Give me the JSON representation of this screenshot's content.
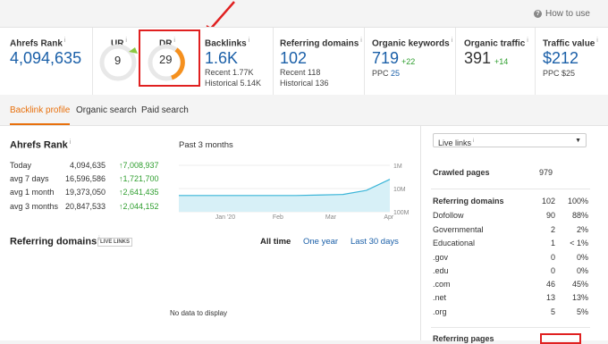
{
  "help": {
    "label": "How to use"
  },
  "metrics": {
    "ahrefs_rank": {
      "label": "Ahrefs Rank",
      "value": "4,094,635"
    },
    "ur": {
      "label": "UR",
      "value": "9"
    },
    "dr": {
      "label": "DR",
      "value": "29"
    },
    "backlinks": {
      "label": "Backlinks",
      "value": "1.6K",
      "recent": "Recent 1.77K",
      "historical": "Historical 5.14K"
    },
    "referring_domains": {
      "label": "Referring domains",
      "value": "102",
      "recent": "Recent 118",
      "historical": "Historical 136"
    },
    "organic_keywords": {
      "label": "Organic keywords",
      "value": "719",
      "delta": "+22",
      "ppc_label": "PPC",
      "ppc": "25"
    },
    "organic_traffic": {
      "label": "Organic traffic",
      "value": "391",
      "delta": "+14"
    },
    "traffic_value": {
      "label": "Traffic value",
      "value": "$212",
      "ppc": "PPC $25"
    }
  },
  "tabs": [
    {
      "label": "Backlink profile"
    },
    {
      "label": "Organic search"
    },
    {
      "label": "Paid search"
    }
  ],
  "rank_section": {
    "title": "Ahrefs Rank",
    "rows": [
      {
        "label": "Today",
        "value": "4,094,635",
        "change": "↑7,008,937"
      },
      {
        "label": "avg 7 days",
        "value": "16,596,586",
        "change": "↑1,721,700"
      },
      {
        "label": "avg 1 month",
        "value": "19,373,050",
        "change": "↑2,641,435"
      },
      {
        "label": "avg 3 months",
        "value": "20,847,533",
        "change": "↑2,044,152"
      }
    ]
  },
  "chart_data": {
    "type": "area",
    "title": "Past 3 months",
    "x_ticks": [
      "Jan '20",
      "Feb",
      "Mar",
      "Apr"
    ],
    "y_ticks": [
      "1M",
      "10M",
      "100M"
    ],
    "scale": "log",
    "series": [
      {
        "values": [
          20000000,
          20000000,
          20000000,
          20000000,
          20000000,
          20000000,
          19000000,
          18000000,
          12000000,
          4000000
        ]
      }
    ]
  },
  "ref_section": {
    "title": "Referring domains",
    "badge": "LIVE LINKS",
    "filters": [
      "All time",
      "One year",
      "Last 30 days"
    ],
    "empty": "No data to display"
  },
  "side": {
    "dropdown": "Live links",
    "crawled_label": "Crawled pages",
    "crawled_value": "979",
    "rows": [
      {
        "label": "Referring domains",
        "value": "102",
        "pct": "100%"
      },
      {
        "label": "Dofollow",
        "value": "90",
        "pct": "88%"
      },
      {
        "label": "Governmental",
        "value": "2",
        "pct": "2%"
      },
      {
        "label": "Educational",
        "value": "1",
        "pct": "< 1%"
      },
      {
        "label": ".gov",
        "value": "0",
        "pct": "0%"
      },
      {
        "label": ".edu",
        "value": "0",
        "pct": "0%"
      },
      {
        "label": ".com",
        "value": "46",
        "pct": "45%"
      },
      {
        "label": ".net",
        "value": "13",
        "pct": "13%"
      },
      {
        "label": ".org",
        "value": "5",
        "pct": "5%"
      }
    ],
    "bottom_label": "Referring pages"
  },
  "colors": {
    "accent": "#e8700c",
    "link": "#1a5fa8",
    "green": "#2e9e2e",
    "annotation": "#e02020"
  }
}
